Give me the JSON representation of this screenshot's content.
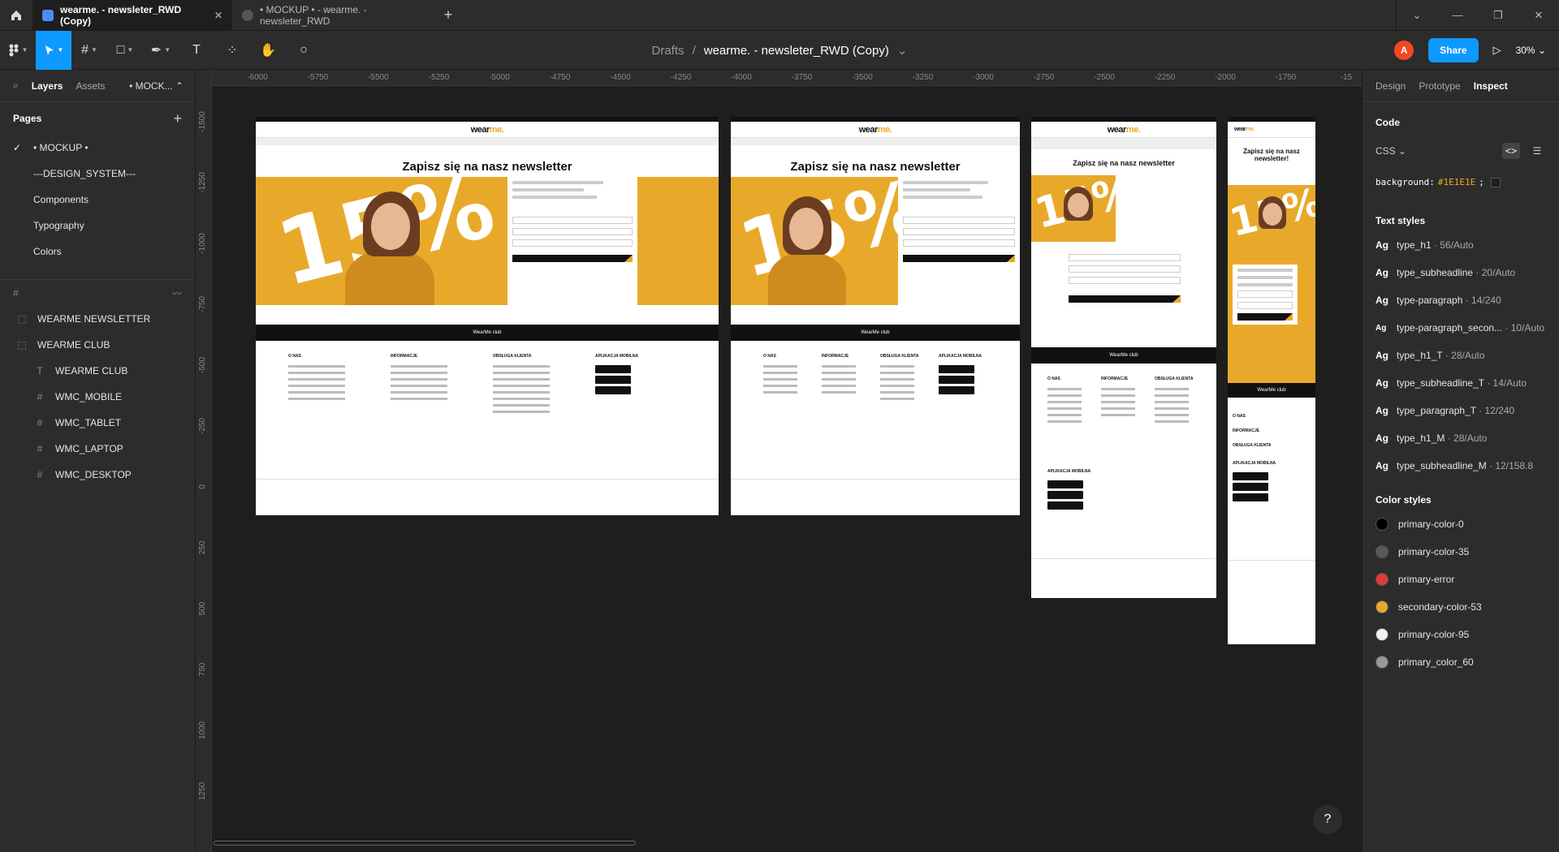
{
  "tabs": [
    {
      "label": "wearme. - newsleter_RWD (Copy)",
      "active": true
    },
    {
      "label": "• MOCKUP • - wearme. - newsleter_RWD",
      "active": false
    }
  ],
  "breadcrumb": {
    "parent": "Drafts",
    "separator": "/",
    "file": "wearme. - newsleter_RWD (Copy)"
  },
  "toolbar": {
    "avatar_letter": "A",
    "share_label": "Share",
    "zoom": "30%"
  },
  "left_panel": {
    "tabs": {
      "layers": "Layers",
      "assets": "Assets",
      "page": "• MOCK..."
    },
    "pages_title": "Pages",
    "pages": [
      "• MOCKUP •",
      "---DESIGN_SYSTEM---",
      "Components",
      "Typography",
      "Colors"
    ],
    "layers": [
      {
        "name": "WEARME NEWSLETTER",
        "child": false
      },
      {
        "name": "WEARME CLUB",
        "child": false
      },
      {
        "name": "WEARME CLUB",
        "child": true,
        "icon": "T"
      },
      {
        "name": "WMC_MOBILE",
        "child": true,
        "icon": "#"
      },
      {
        "name": "WMC_TABLET",
        "child": true,
        "icon": "#"
      },
      {
        "name": "WMC_LAPTOP",
        "child": true,
        "icon": "#"
      },
      {
        "name": "WMC_DESKTOP",
        "child": true,
        "icon": "#"
      }
    ]
  },
  "ruler": {
    "top": [
      "-6000",
      "-5750",
      "-5500",
      "-5250",
      "-5000",
      "-4750",
      "-4500",
      "-4250",
      "-4000",
      "-3750",
      "-3500",
      "-3250",
      "-3000",
      "-2750",
      "-2500",
      "-2250",
      "-2000",
      "-1750",
      "-15"
    ],
    "left": [
      "-1500",
      "-1250",
      "-1000",
      "-750",
      "-500",
      "-250",
      "0",
      "250",
      "500",
      "750",
      "1000",
      "1250"
    ]
  },
  "frames": {
    "title": "Zapisz się na nasz newsletter",
    "title_mobile": "Zapisz się na nasz newsletter!",
    "subtitle": "I ZGARNIJ 15% zniżki* NA PIERWSZE ZAKUPY!",
    "percent": "15%",
    "club": "WearMe club",
    "logo_main": "wear",
    "logo_accent": "me.",
    "col_onas": "O NAS",
    "col_info": "INFORMACJE",
    "col_obsluga": "OBSŁUGA KLIENTA",
    "col_app": "APLIKACJA MOBILNA"
  },
  "right_panel": {
    "tabs": {
      "design": "Design",
      "prototype": "Prototype",
      "inspect": "Inspect"
    },
    "code_title": "Code",
    "css_label": "CSS",
    "code_prop": "background:",
    "code_value": "#1E1E1E",
    "code_end": ";",
    "text_styles_title": "Text styles",
    "text_styles": [
      {
        "name": "type_h1",
        "meta": " · 56/Auto"
      },
      {
        "name": "type_subheadline",
        "meta": " · 20/Auto"
      },
      {
        "name": "type-paragraph",
        "meta": " · 14/240"
      },
      {
        "name": "type-paragraph_secon...",
        "meta": " · 10/Auto"
      },
      {
        "name": "type_h1_T",
        "meta": " · 28/Auto"
      },
      {
        "name": "type_subheadline_T",
        "meta": " · 14/Auto"
      },
      {
        "name": "type_paragraph_T",
        "meta": " · 12/240"
      },
      {
        "name": "type_h1_M",
        "meta": " · 28/Auto"
      },
      {
        "name": "type_subheadline_M",
        "meta": " · 12/158.8"
      }
    ],
    "color_styles_title": "Color styles",
    "color_styles": [
      {
        "name": "primary-color-0",
        "color": "#000000"
      },
      {
        "name": "primary-color-35",
        "color": "#595959"
      },
      {
        "name": "primary-error",
        "color": "#e03a3a"
      },
      {
        "name": "secondary-color-53",
        "color": "#e8a92b"
      },
      {
        "name": "primary-color-95",
        "color": "#f2f2f2"
      },
      {
        "name": "primary_color_60",
        "color": "#999999"
      }
    ]
  },
  "help": "?"
}
